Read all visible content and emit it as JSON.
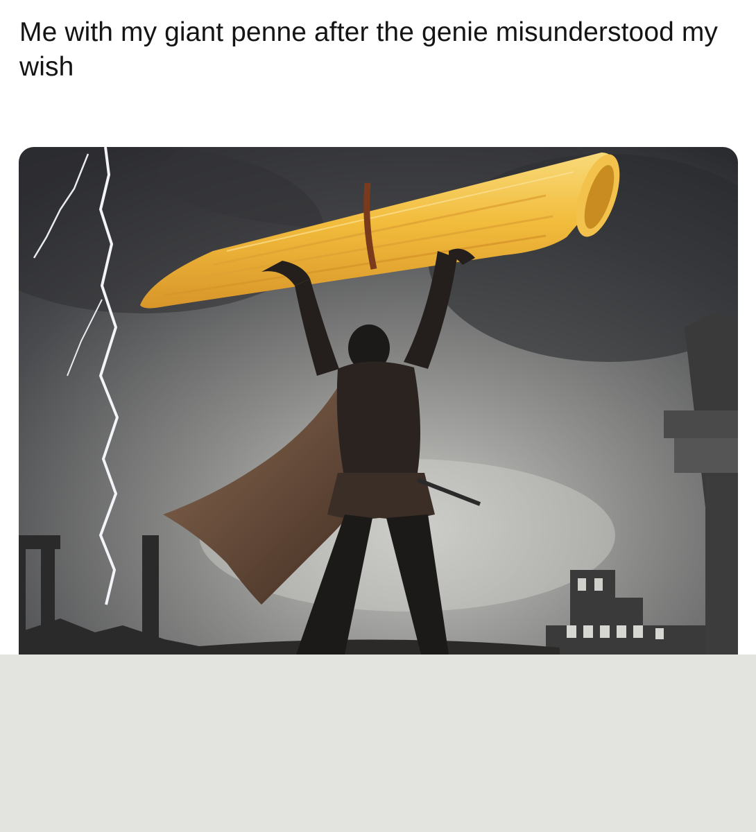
{
  "post": {
    "caption": "Me with my giant penne after the genie misunderstood my wish"
  },
  "image": {
    "subject-icon": "warrior-lifting-giant-penne",
    "colors": {
      "sky_dark": "#2e3034",
      "sky_light": "#b4b4b2",
      "penne": "#f2bc3c",
      "penne_highlight": "#f8da7a",
      "lightning": "#f2f4f8",
      "silhouette": "#1c1a18",
      "cape": "#6a4a36"
    }
  },
  "bottom_area": {
    "color": "#e3e3df"
  }
}
